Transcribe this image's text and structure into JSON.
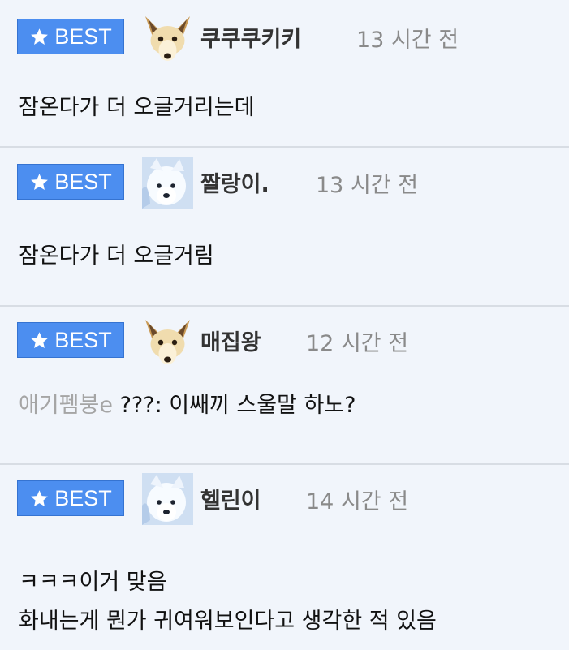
{
  "badge_label": "BEST",
  "colors": {
    "badge_bg": "#4c8ef0",
    "page_bg": "#f1f5fb",
    "divider": "#d8dde4",
    "time_text": "#8a8a8a",
    "mention_text": "#a5a5a5"
  },
  "comments": [
    {
      "avatar": "fennec-fox-avatar",
      "author": "쿠쿠쿠키키",
      "time": "13 시간 전",
      "mention": "",
      "lines": [
        "잠온다가 더 오글거리는데"
      ]
    },
    {
      "avatar": "white-dog-avatar",
      "author": "짤랑이.",
      "time": "13 시간 전",
      "mention": "",
      "lines": [
        "잠온다가 더 오글거림"
      ]
    },
    {
      "avatar": "fennec-fox-avatar",
      "author": "매집왕",
      "time": "12 시간 전",
      "mention": "애기펨붕e",
      "lines": [
        "???: 이쌔끼 스울말 하노?"
      ]
    },
    {
      "avatar": "white-dog-avatar",
      "author": "헬린이",
      "time": "14 시간 전",
      "mention": "",
      "lines": [
        "ㅋㅋㅋ이거 맞음",
        "화내는게 뭔가 귀여워보인다고 생각한 적 있음"
      ]
    }
  ]
}
